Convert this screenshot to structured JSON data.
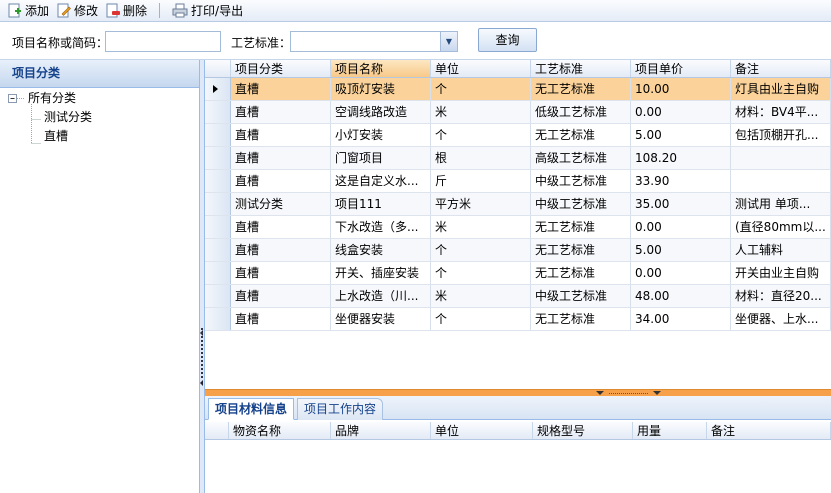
{
  "toolbar": {
    "add_label": "添加",
    "edit_label": "修改",
    "delete_label": "删除",
    "print_label": "打印/导出"
  },
  "search": {
    "name_label": "项目名称或简码：",
    "name_value": "",
    "standard_label": "工艺标准：",
    "standard_value": "",
    "query_label": "查询"
  },
  "left_panel": {
    "title": "项目分类",
    "tree": {
      "root": "所有分类",
      "children": [
        "测试分类",
        "直槽"
      ]
    }
  },
  "grid": {
    "columns": [
      "项目分类",
      "项目名称",
      "单位",
      "工艺标准",
      "项目单价",
      "备注"
    ],
    "selected_row": 0,
    "rows": [
      [
        "直槽",
        "吸顶灯安装",
        "个",
        "无工艺标准",
        "10.00",
        "灯具由业主自购"
      ],
      [
        "直槽",
        "空调线路改造",
        "米",
        "低级工艺标准",
        "0.00",
        "材料：BV4平..."
      ],
      [
        "直槽",
        "小灯安装",
        "个",
        "无工艺标准",
        "5.00",
        "包括顶棚开孔..."
      ],
      [
        "直槽",
        "门窗项目",
        "根",
        "高级工艺标准",
        "108.20",
        ""
      ],
      [
        "直槽",
        "这是自定义水...",
        "斤",
        "中级工艺标准",
        "33.90",
        ""
      ],
      [
        "测试分类",
        "项目111",
        "平方米",
        "中级工艺标准",
        "35.00",
        "测试用  单项..."
      ],
      [
        "直槽",
        "下水改造（多...",
        "米",
        "无工艺标准",
        "0.00",
        "(直径80mm以..."
      ],
      [
        "直槽",
        "线盒安装",
        "个",
        "无工艺标准",
        "5.00",
        "人工辅料"
      ],
      [
        "直槽",
        "开关、插座安装",
        "个",
        "无工艺标准",
        "0.00",
        "开关由业主自购"
      ],
      [
        "直槽",
        "上水改造（川...",
        "米",
        "中级工艺标准",
        "48.00",
        "材料：直径20..."
      ],
      [
        "直槽",
        "坐便器安装",
        "个",
        "无工艺标准",
        "34.00",
        "坐便器、上水..."
      ]
    ]
  },
  "bottom": {
    "tabs": [
      "项目材料信息",
      "项目工作内容"
    ],
    "active_tab": 0,
    "columns": [
      "物资名称",
      "品牌",
      "单位",
      "规格型号",
      "用量",
      "备注"
    ]
  },
  "colors": {
    "selected_row": "#fbd39a",
    "header_text": "#15428b",
    "splitter": "#f6a14a"
  }
}
